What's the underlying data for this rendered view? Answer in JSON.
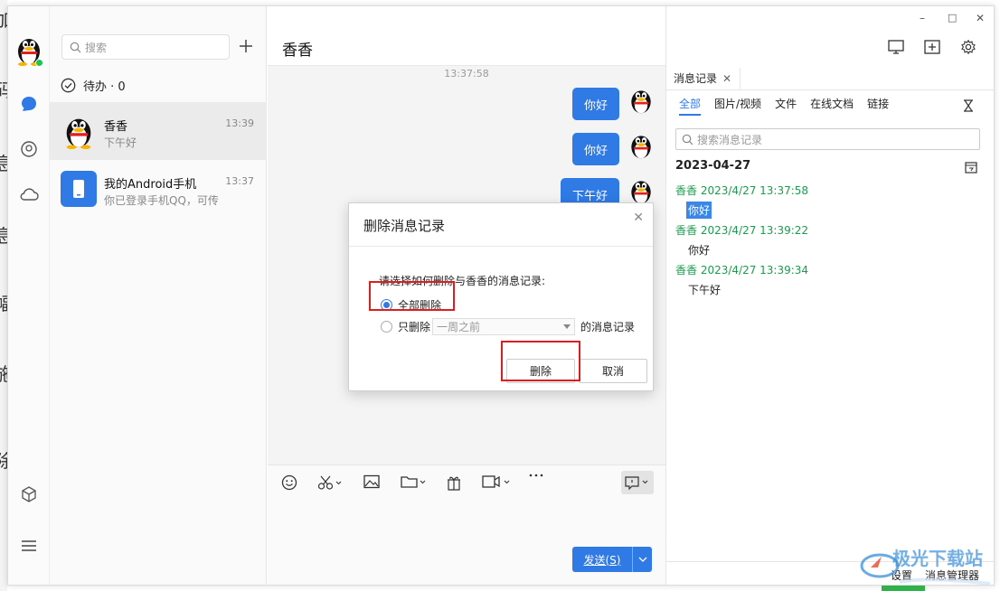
{
  "window": {
    "controls": [
      "–",
      "□",
      "✕"
    ]
  },
  "background_glyphs": [
    "加",
    "码",
    "息",
    "息",
    "幅",
    "施",
    "除"
  ],
  "conversations": {
    "search_placeholder": "搜索",
    "todo_label": "待办 · 0",
    "items": [
      {
        "name": "香香",
        "time": "13:39",
        "preview": "下午好"
      },
      {
        "name": "我的Android手机",
        "time": "13:37",
        "preview": "你已登录手机QQ，可传"
      }
    ]
  },
  "chat": {
    "title": "香香",
    "timestamp": "13:37:58",
    "messages": [
      "你好",
      "你好",
      "下午好"
    ],
    "send_label": "发送(S)",
    "toolbar_icons": [
      "emoji-icon",
      "scissors-icon",
      "image-icon",
      "folder-icon",
      "gift-icon",
      "video-icon",
      "more-icon",
      "history-icon"
    ]
  },
  "history_panel": {
    "tab_label": "消息记录",
    "filters": [
      "全部",
      "图片/视频",
      "文件",
      "在线文档",
      "链接"
    ],
    "search_placeholder": "搜索消息记录",
    "date": "2023-04-27",
    "entries": [
      {
        "header": "香香 2023/4/27 13:37:58",
        "text": "你好"
      },
      {
        "header": "香香 2023/4/27 13:39:22",
        "text": "你好"
      },
      {
        "header": "香香 2023/4/27 13:39:34",
        "text": "下午好"
      }
    ],
    "bottom_settings": "设置",
    "bottom_manager": "消息管理器"
  },
  "dialog": {
    "title": "删除消息记录",
    "prompt": "请选择如何删除与香香的消息记录:",
    "option_all": "全部删除",
    "option_partial": "只删除",
    "select_value": "一周之前",
    "suffix": "的消息记录",
    "delete_label": "删除",
    "cancel_label": "取消"
  },
  "watermark": "极光下载站",
  "colors": {
    "accent": "#2f7ae5",
    "highlight": "#d92020",
    "log_green": "#1c9b4e"
  }
}
